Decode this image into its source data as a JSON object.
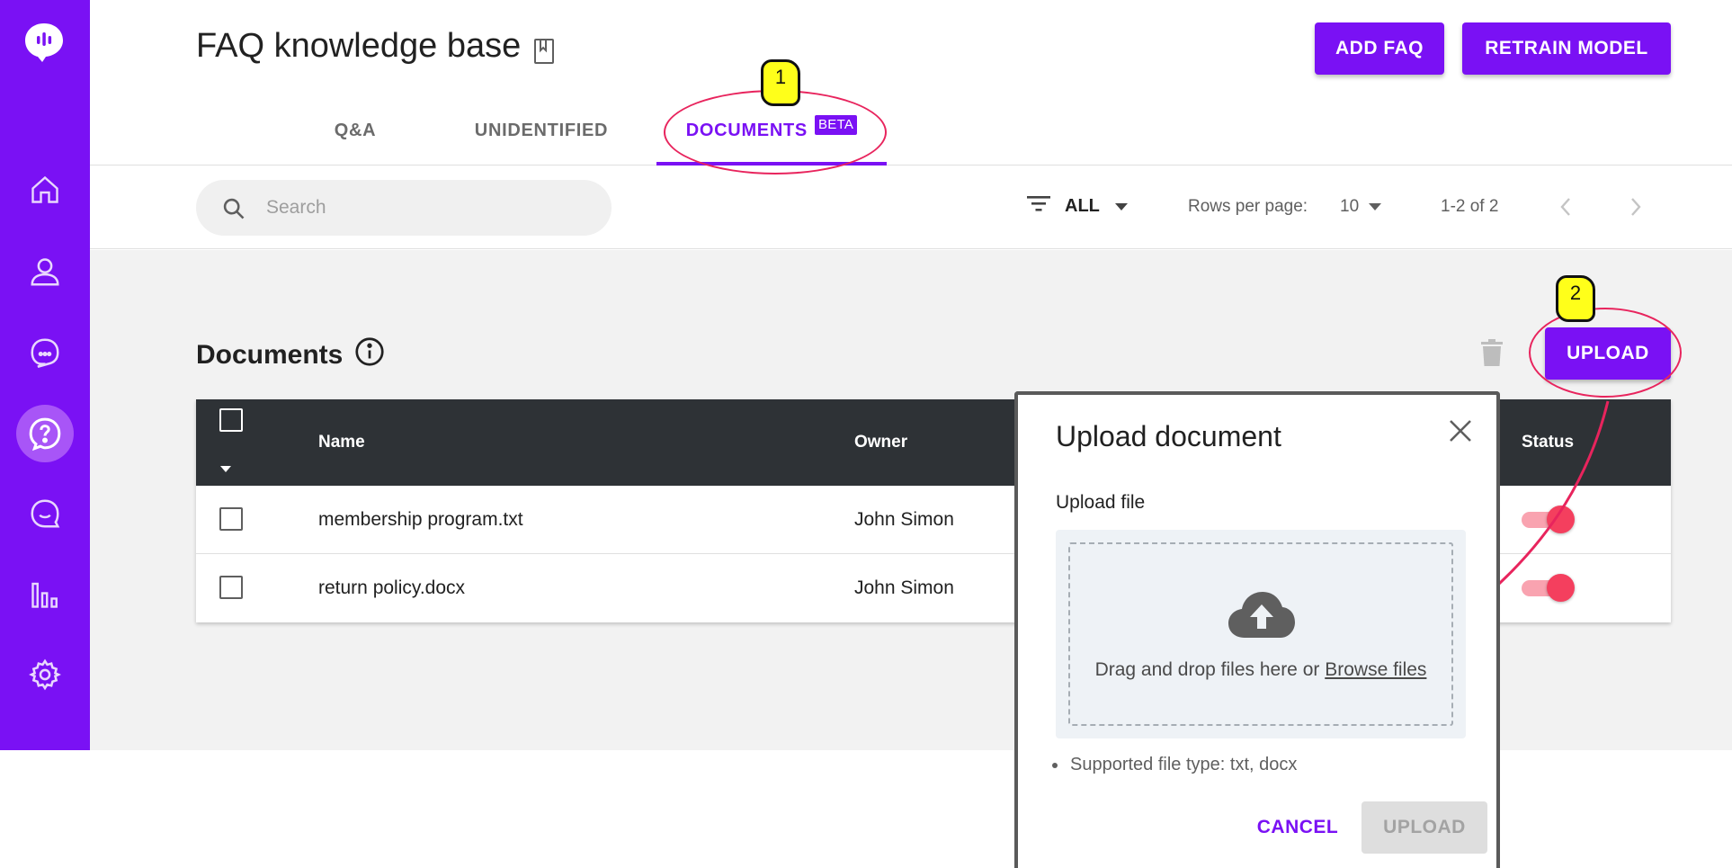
{
  "header": {
    "title": "FAQ knowledge base",
    "add_faq_label": "ADD FAQ",
    "retrain_label": "RETRAIN MODEL"
  },
  "tabs": [
    {
      "label": "Q&A"
    },
    {
      "label": "UNIDENTIFIED"
    },
    {
      "label": "DOCUMENTS",
      "badge": "BETA",
      "active": true
    }
  ],
  "toolbar": {
    "search_placeholder": "Search",
    "filter_value": "ALL",
    "rows_per_page_label": "Rows per page:",
    "rows_per_page_value": "10",
    "pagination_text": "1-2 of 2"
  },
  "documents": {
    "title": "Documents",
    "upload_label": "UPLOAD",
    "columns": {
      "name": "Name",
      "owner": "Owner",
      "status": "Status"
    },
    "rows": [
      {
        "name": "membership program.txt",
        "owner": "John Simon",
        "status_on": true
      },
      {
        "name": "return policy.docx",
        "owner": "John Simon",
        "status_on": true
      }
    ]
  },
  "dialog": {
    "title": "Upload document",
    "upload_file_label": "Upload file",
    "drop_text": "Drag and drop files here or",
    "browse_text": "Browse files",
    "note": "Supported file type: txt, docx",
    "cancel_label": "CANCEL",
    "upload_label": "UPLOAD"
  },
  "annotations": {
    "marker_1": "1",
    "marker_2": "2"
  },
  "colors": {
    "brand": "#7a11f4",
    "annotation": "#e8245d",
    "marker": "#ffff1a",
    "toggle": "#f43f5e"
  }
}
